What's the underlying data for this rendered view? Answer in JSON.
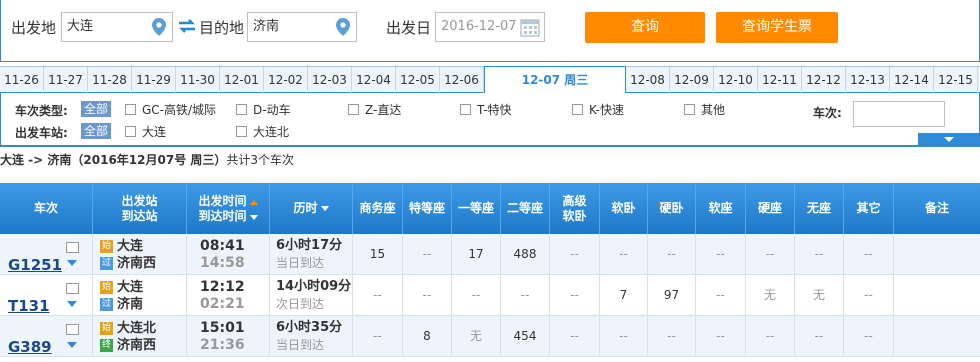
{
  "search": {
    "from_label": "出发地",
    "from_value": "大连",
    "to_label": "目的地",
    "to_value": "济南",
    "date_label": "出发日",
    "date_value": "2016-12-07",
    "query_button": "查询",
    "student_button": "查询学生票"
  },
  "date_tabs": [
    {
      "label": "11-26"
    },
    {
      "label": "11-27"
    },
    {
      "label": "11-28"
    },
    {
      "label": "11-29"
    },
    {
      "label": "11-30"
    },
    {
      "label": "12-01"
    },
    {
      "label": "12-02"
    },
    {
      "label": "12-03"
    },
    {
      "label": "12-04"
    },
    {
      "label": "12-05"
    },
    {
      "label": "12-06"
    },
    {
      "label": "12-07 周三",
      "active": true
    },
    {
      "label": "12-08"
    },
    {
      "label": "12-09"
    },
    {
      "label": "12-10"
    },
    {
      "label": "12-11"
    },
    {
      "label": "12-12"
    },
    {
      "label": "12-13"
    },
    {
      "label": "12-14"
    },
    {
      "label": "12-15"
    }
  ],
  "filters": {
    "type_label": "车次类型:",
    "all": "全部",
    "types": [
      "GC-高铁/城际",
      "D-动车",
      "Z-直达",
      "T-特快",
      "K-快速",
      "其他"
    ],
    "station_label": "出发车站:",
    "stations": [
      "大连",
      "大连北"
    ],
    "train_no_label": "车次:"
  },
  "route_summary": {
    "route": "大连 -> 济南（2016年12月07号  周三）",
    "count": "共计3个车次"
  },
  "table": {
    "headers": {
      "train": "车次",
      "stations": [
        "出发站",
        "到达站"
      ],
      "times": [
        "出发时间",
        "到达时间"
      ],
      "duration": "历时",
      "business": "商务座",
      "special": "特等座",
      "first": "一等座",
      "second": "二等座",
      "adv_soft": [
        "高级",
        "软卧"
      ],
      "soft_sleeper": "软卧",
      "hard_sleeper": "硬卧",
      "soft_seat": "软座",
      "hard_seat": "硬座",
      "no_seat": "无座",
      "other": "其它",
      "remark": "备注"
    },
    "rows": [
      {
        "code": "G1251",
        "from_badge": "始",
        "from": "大连",
        "to_badge": "过",
        "to": "济南西",
        "dep": "08:41",
        "arr": "14:58",
        "duration": "6小时17分",
        "arrival_note": "当日到达",
        "seats": [
          "15",
          "--",
          "17",
          "488",
          "--",
          "--",
          "--",
          "--",
          "--",
          "--",
          "--",
          ""
        ]
      },
      {
        "code": "T131",
        "from_badge": "始",
        "from": "大连",
        "to_badge": "过",
        "to": "济南",
        "dep": "12:12",
        "arr": "02:21",
        "duration": "14小时09分",
        "arrival_note": "次日到达",
        "seats": [
          "--",
          "--",
          "--",
          "--",
          "--",
          "7",
          "97",
          "--",
          "无",
          "无",
          "--",
          ""
        ]
      },
      {
        "code": "G389",
        "from_badge": "始",
        "from": "大连北",
        "to_badge": "终",
        "to": "济南西",
        "dep": "15:01",
        "arr": "21:36",
        "duration": "6小时35分",
        "arrival_note": "当日到达",
        "seats": [
          "--",
          "8",
          "无",
          "454",
          "--",
          "--",
          "--",
          "--",
          "--",
          "--",
          "--",
          ""
        ]
      }
    ]
  },
  "colors": {
    "accent": "#2f8ad8",
    "button": "#ff8a00",
    "badge_start": "#e3a21a",
    "badge_pass": "#4b9be0",
    "badge_end": "#3aa54a"
  }
}
